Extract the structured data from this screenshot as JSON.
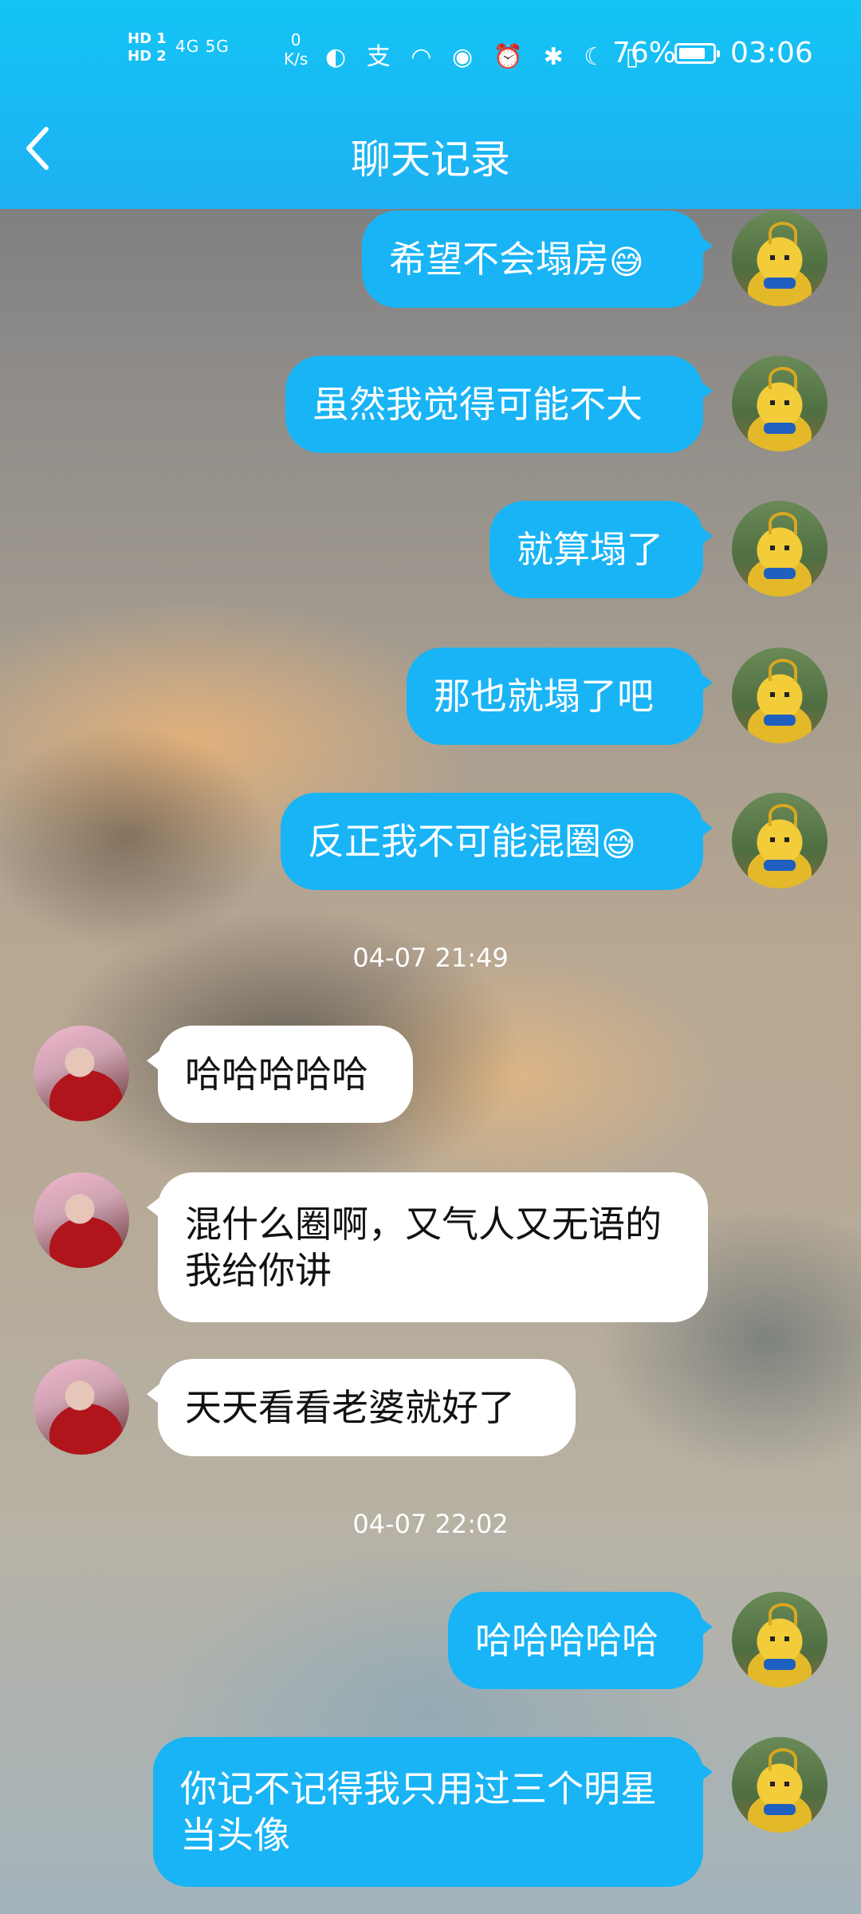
{
  "status_bar": {
    "sim_labels": "HD 1\nHD 2",
    "signal_text": "4G  5G",
    "net_speed": "0\nK/s",
    "icons_text": "◐ 支 ◠ ◉ ⏰ ✱ ☾ ▯",
    "battery_percent": "76%",
    "battery_level": 0.76,
    "time": "03:06"
  },
  "header": {
    "title": "聊天记录",
    "back_icon": "chevron-left-icon",
    "color": "#18b8f4"
  },
  "messages": [
    {
      "side": "me",
      "text": "希望不会塌房",
      "emoji": "😅"
    },
    {
      "side": "me",
      "text": "虽然我觉得可能不大"
    },
    {
      "side": "me",
      "text": "就算塌了"
    },
    {
      "side": "me",
      "text": "那也就塌了吧"
    },
    {
      "side": "me",
      "text": "反正我不可能混圈",
      "emoji": "😅"
    },
    {
      "type": "timestamp",
      "text": "04-07 21:49"
    },
    {
      "side": "them",
      "text": "哈哈哈哈哈"
    },
    {
      "side": "them",
      "text": "混什么圈啊，又气人又无语的我给你讲"
    },
    {
      "side": "them",
      "text": "天天看看老婆就好了"
    },
    {
      "type": "timestamp",
      "text": "04-07 22:02"
    },
    {
      "side": "me",
      "text": "哈哈哈哈哈"
    },
    {
      "side": "me",
      "text": "你记不记得我只用过三个明星当头像"
    }
  ],
  "colors": {
    "my_bubble": "#19b4f5",
    "their_bubble": "#ffffff"
  }
}
